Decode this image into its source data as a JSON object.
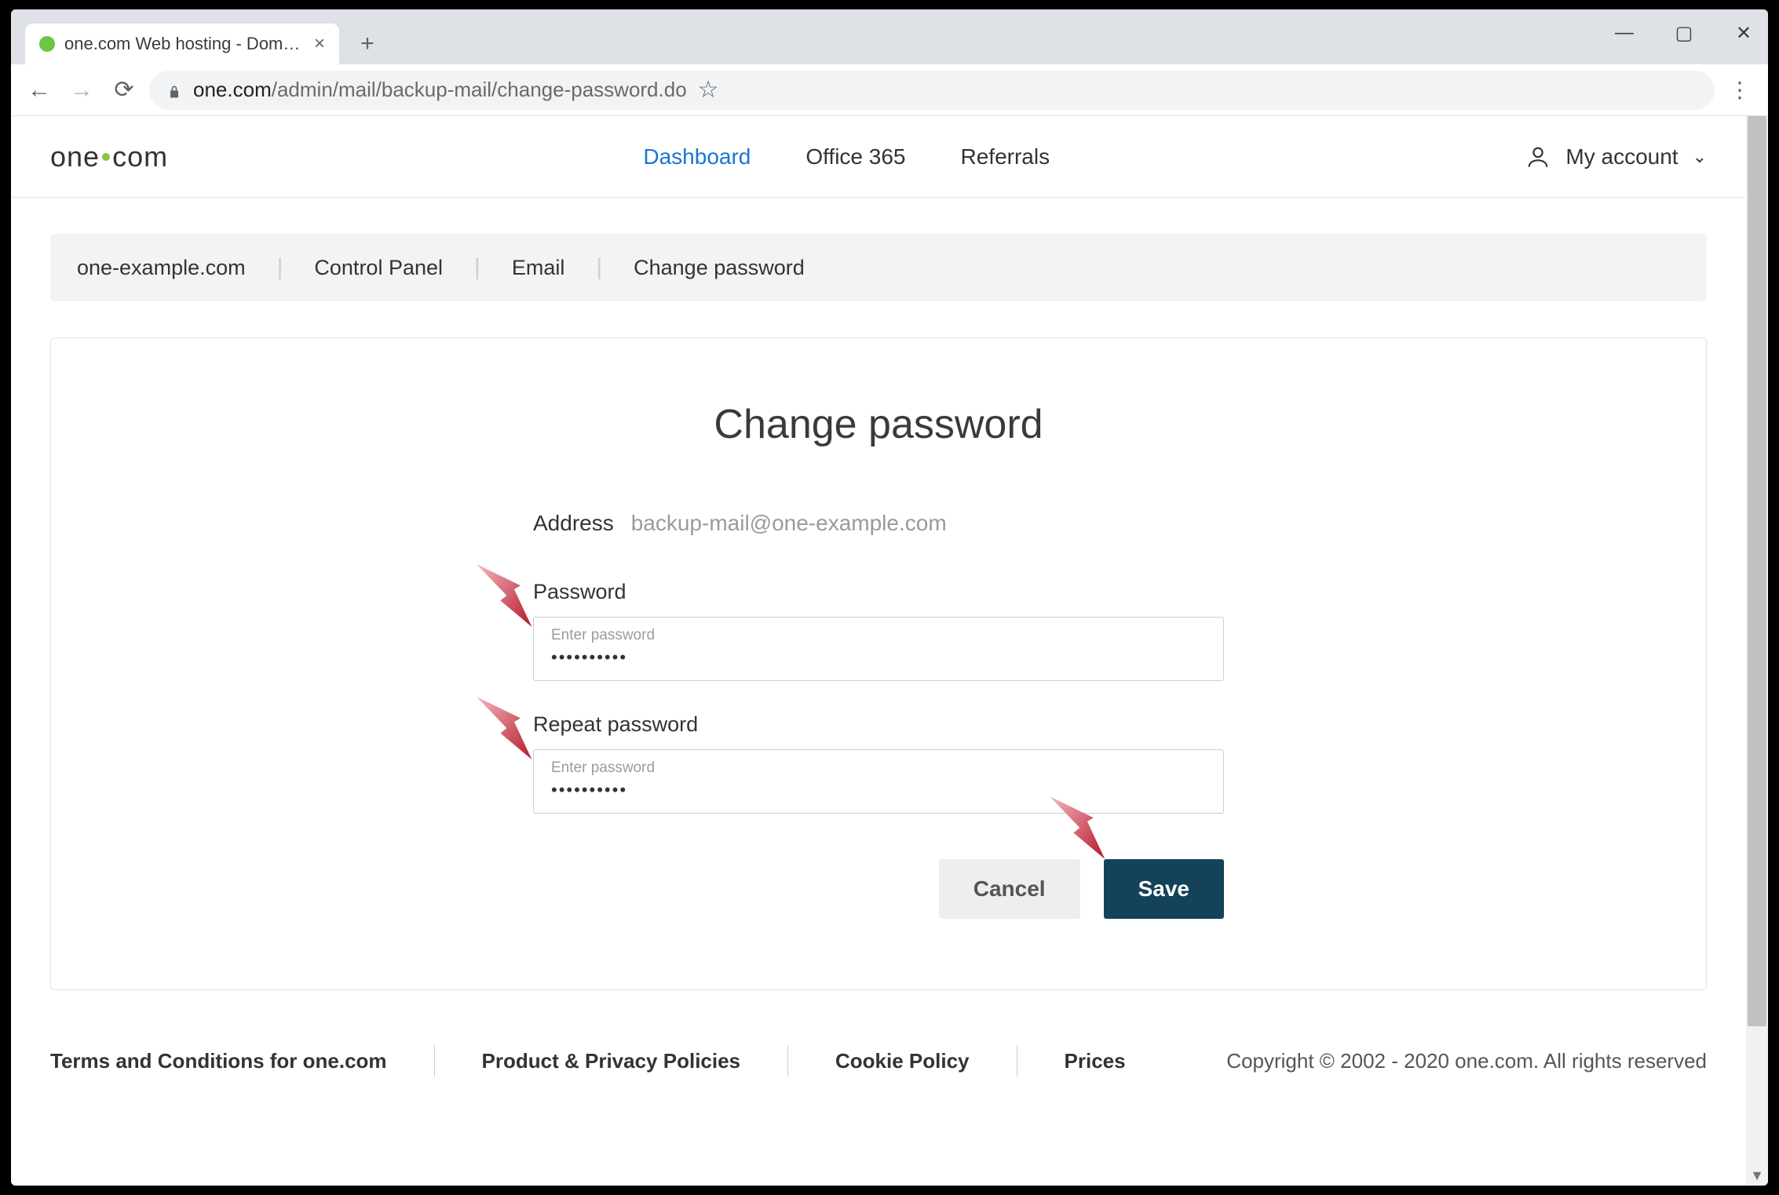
{
  "browser": {
    "tab_title": "one.com Web hosting  -  Domain",
    "url_host": "one.com",
    "url_path": "/admin/mail/backup-mail/change-password.do"
  },
  "header": {
    "logo_prefix": "one",
    "logo_suffix": "com",
    "nav": {
      "dashboard": "Dashboard",
      "office365": "Office 365",
      "referrals": "Referrals"
    },
    "account_label": "My account"
  },
  "breadcrumb": {
    "items": [
      "one-example.com",
      "Control Panel",
      "Email",
      "Change password"
    ]
  },
  "form": {
    "title": "Change password",
    "address_label": "Address",
    "address_value": "backup-mail@one-example.com",
    "password_label": "Password",
    "password_floating": "Enter password",
    "password_value": "••••••••••",
    "repeat_label": "Repeat password",
    "repeat_floating": "Enter password",
    "repeat_value": "••••••••••",
    "cancel_label": "Cancel",
    "save_label": "Save"
  },
  "footer": {
    "terms": "Terms and Conditions for one.com",
    "policies": "Product & Privacy Policies",
    "cookie": "Cookie Policy",
    "prices": "Prices",
    "copyright": "Copyright © 2002 - 2020 one.com. All rights reserved"
  }
}
